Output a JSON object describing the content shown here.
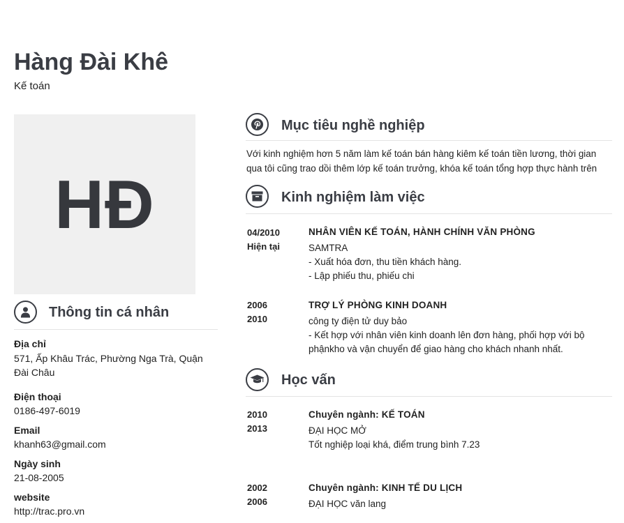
{
  "header": {
    "name": "Hàng Đài Khê",
    "job_title": "Kế toán"
  },
  "avatar": {
    "initials": "HĐ"
  },
  "personal": {
    "title": "Thông tin cá nhân",
    "address_label": "Địa chỉ",
    "address_line1": "571, Ấp Khâu Trác, Phường Nga Trà, Quận",
    "address_line2": "Đài Châu",
    "phone_label": "Điện thoại",
    "phone": "0186-497-6019",
    "email_label": "Email",
    "email": "khanh63@gmail.com",
    "birthday_label": "Ngày sinh",
    "birthday": "21-08-2005",
    "website_label": "website",
    "website": "http://trac.pro.vn"
  },
  "objective": {
    "title": "Mục tiêu nghề nghiệp",
    "line1": "Với kinh nghiệm hơn 5 năm làm kế toán bán hàng kiêm kế toán tiền lương, thời gian",
    "line2": "qua tôi cũng trao dồi thêm lớp kế toán trưởng, khóa kế toán tổng hợp thực hành trên"
  },
  "experience": {
    "title": "Kinh nghiệm làm việc",
    "items": [
      {
        "start": "04/2010",
        "end": "Hiện tại",
        "position": "NHÂN VIÊN KẾ TOÁN, HÀNH CHÍNH VĂN PHÒNG",
        "company": "SAMTRA",
        "line1": "- Xuất hóa đơn, thu tiền khách hàng.",
        "line2": "- Lập phiếu thu, phiếu chi"
      },
      {
        "start": "2006",
        "end": "2010",
        "position": "TRỢ LÝ PHÒNG KINH DOANH",
        "company": "công ty điện tử duy bảo",
        "line1": "- Kết hợp với nhân viên kinh doanh lên đơn hàng, phối hợp với bộ",
        "line2": "phậnkho và vận chuyển để giao hàng cho khách nhanh nhất."
      }
    ]
  },
  "education": {
    "title": "Học vấn",
    "items": [
      {
        "start": "2010",
        "end": "2013",
        "major": "Chuyên ngành: KẾ TOÁN",
        "school": "ĐẠI HỌC MỞ",
        "note": "Tốt nghiệp loại khá, điểm trung bình 7.23"
      },
      {
        "start": "2002",
        "end": "2006",
        "major": "Chuyên ngành: KINH TẾ DU LỊCH",
        "school": "ĐẠI HỌC văn lang"
      }
    ]
  }
}
